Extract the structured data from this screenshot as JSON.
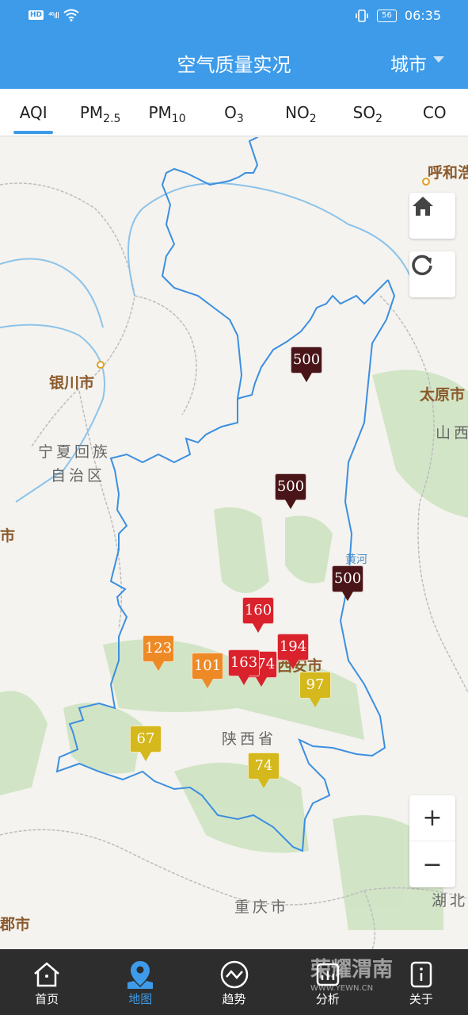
{
  "status": {
    "hd": "HD",
    "signal": "⁴⁶ıll",
    "battery": "56",
    "time": "06:35"
  },
  "header": {
    "title": "空气质量实况",
    "city_label": "城市"
  },
  "tabs": [
    {
      "main": "AQI",
      "sub": ""
    },
    {
      "main": "PM",
      "sub": "2.5"
    },
    {
      "main": "PM",
      "sub": "10"
    },
    {
      "main": "O",
      "sub": "3"
    },
    {
      "main": "NO",
      "sub": "2"
    },
    {
      "main": "SO",
      "sub": "2"
    },
    {
      "main": "CO",
      "sub": ""
    }
  ],
  "places": {
    "yinchuan": "银川市",
    "ningxia1": "宁夏回族",
    "ningxia2": "自治区",
    "taiyuan": "太原市",
    "shanxi": "山西",
    "huhe": "呼和浩",
    "huanghe": "黄河",
    "xian": "西安市",
    "shaanxi": "陕西省",
    "chongqing": "重庆市",
    "hubei": "湖北",
    "left_city": "市",
    "left_bottom": "郡市"
  },
  "markers": [
    {
      "value": "500",
      "color": "#4a1518"
    },
    {
      "value": "500",
      "color": "#4a1518"
    },
    {
      "value": "500",
      "color": "#4a1518"
    },
    {
      "value": "160",
      "color": "#d9222b"
    },
    {
      "value": "194",
      "color": "#d9222b"
    },
    {
      "value": "163",
      "color": "#d9222b"
    },
    {
      "value": "174",
      "color": "#d9222b"
    },
    {
      "value": "123",
      "color": "#ee8a26"
    },
    {
      "value": "101",
      "color": "#ee8a26"
    },
    {
      "value": "97",
      "color": "#d4b81c"
    },
    {
      "value": "67",
      "color": "#d4b81c"
    },
    {
      "value": "74",
      "color": "#d4b81c"
    }
  ],
  "controls": {
    "home_icon": "home-icon",
    "refresh_icon": "refresh-icon",
    "zoom_in": "+",
    "zoom_out": "−"
  },
  "nav": [
    {
      "label": "首页",
      "icon": "home-outline-icon"
    },
    {
      "label": "地图",
      "icon": "map-pin-icon"
    },
    {
      "label": "趋势",
      "icon": "trend-icon"
    },
    {
      "label": "分析",
      "icon": "analysis-icon"
    },
    {
      "label": "关于",
      "icon": "info-icon"
    }
  ],
  "watermark": {
    "main": "荣耀渭南",
    "sub": "WWW.YEWN.CN"
  }
}
